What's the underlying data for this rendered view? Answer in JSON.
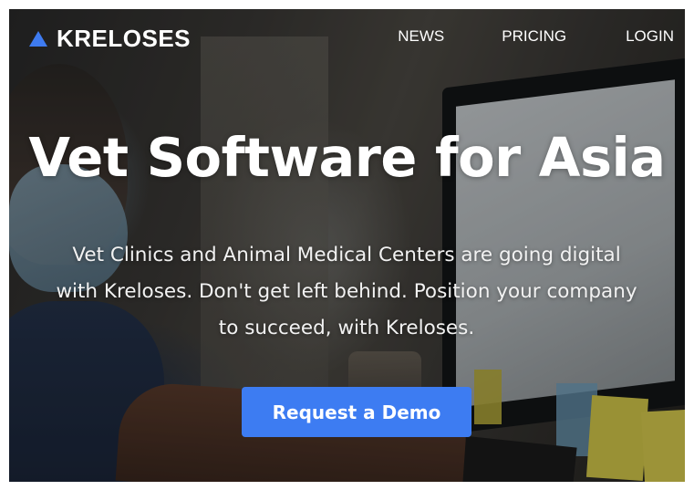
{
  "brand": {
    "name": "KRELOSES",
    "logo_icon": "triangle-logo-icon",
    "accent_color": "#3e7bf0"
  },
  "nav": {
    "items": [
      {
        "label": "NEWS"
      },
      {
        "label": "PRICING"
      },
      {
        "label": "LOGIN"
      }
    ]
  },
  "hero": {
    "title": "Vet Software for Asia",
    "subtitle": "Vet Clinics and Animal Medical Centers are going digital with Kreloses. Don't get left behind. Position your company to succeed, with Kreloses.",
    "cta_label": "Request a Demo",
    "cta_color": "#3d7cf2"
  }
}
